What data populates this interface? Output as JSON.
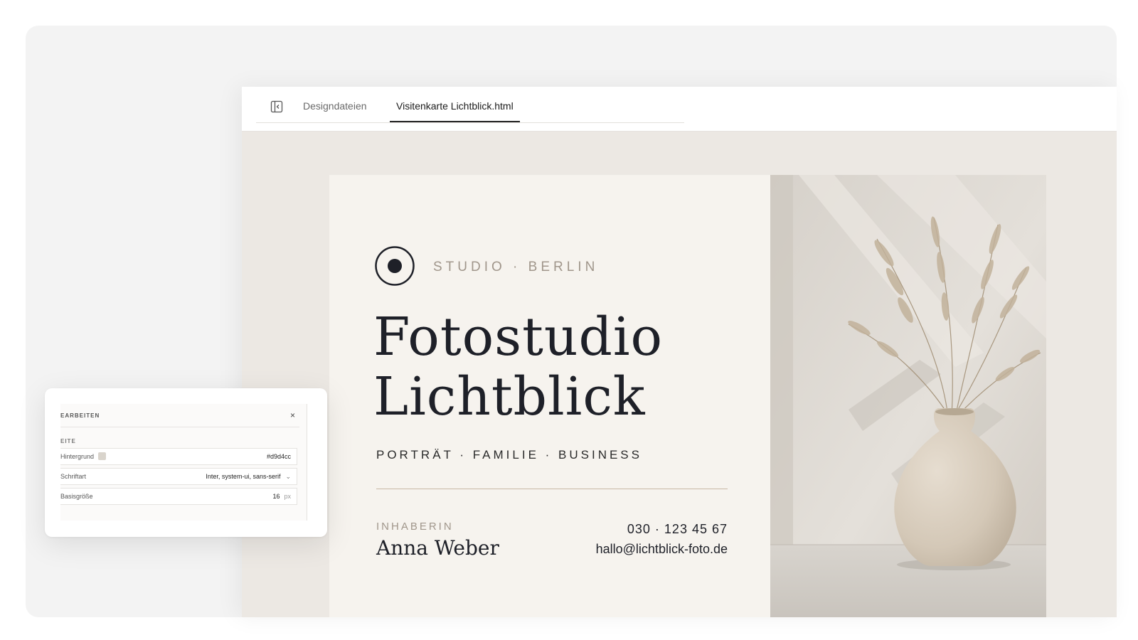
{
  "tabs": {
    "files": "Designdateien",
    "active": "Visitenkarte Lichtblick.html"
  },
  "card": {
    "studio": "STUDIO · BERLIN",
    "title_line1": "Fotostudio",
    "title_line2": "Lichtblick",
    "services": "PORTRÄT · FAMILIE · BUSINESS",
    "owner_label": "INHABERIN",
    "owner_name": "Anna Weber",
    "phone": "030 · 123 45 67",
    "email": "hallo@lichtblick-foto.de"
  },
  "edit_panel": {
    "title": "EARBEITEN",
    "close": "×",
    "section": "EITE",
    "rows": [
      {
        "label": "Hintergrund",
        "value": "#d9d4cc"
      },
      {
        "label": "Schriftart",
        "value": "Inter, system-ui, sans-serif"
      },
      {
        "label": "Basisgröße",
        "value": "16",
        "unit": "px"
      }
    ]
  },
  "colors": {
    "card_background": "#f6f3ee",
    "accent": "#c8b8a4",
    "swatch": "#d9d4cc"
  }
}
